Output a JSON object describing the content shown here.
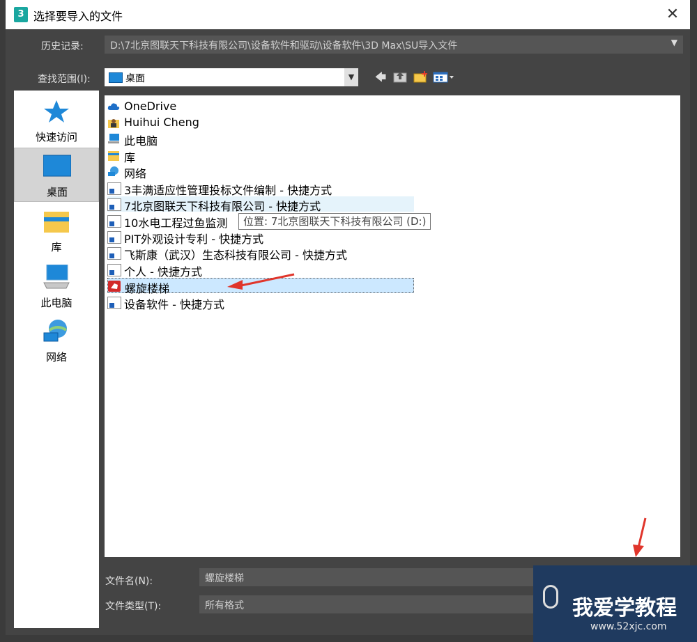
{
  "title_bar": {
    "app_icon": "3",
    "title": "选择要导入的文件",
    "close": "✕"
  },
  "history": {
    "label": "历史记录:",
    "value": "D:\\7北京图联天下科技有限公司\\设备软件和驱动\\设备软件\\3D Max\\SU导入文件"
  },
  "look_in": {
    "label": "查找范围(I):",
    "value": "桌面"
  },
  "places": [
    {
      "label": "快速访问",
      "icon": "star-icon"
    },
    {
      "label": "桌面",
      "icon": "desktop-icon"
    },
    {
      "label": "库",
      "icon": "library-icon"
    },
    {
      "label": "此电脑",
      "icon": "computer-icon"
    },
    {
      "label": "网络",
      "icon": "network-icon"
    }
  ],
  "files": [
    {
      "name": "OneDrive",
      "icon": "cloud-icon"
    },
    {
      "name": "Huihui Cheng",
      "icon": "user-folder-icon"
    },
    {
      "name": "此电脑",
      "icon": "computer-icon"
    },
    {
      "name": "库",
      "icon": "library-icon"
    },
    {
      "name": "网络",
      "icon": "network-icon"
    },
    {
      "name": "3丰满适应性管理投标文件编制 - 快捷方式",
      "icon": "shortcut-icon"
    },
    {
      "name": "7北京图联天下科技有限公司 - 快捷方式",
      "icon": "shortcut-icon"
    },
    {
      "name": "10水电工程过鱼监测",
      "icon": "shortcut-icon"
    },
    {
      "name": "PIT外观设计专利 - 快捷方式",
      "icon": "shortcut-icon"
    },
    {
      "name": "飞斯康（武汉）生态科技有限公司 - 快捷方式",
      "icon": "shortcut-icon"
    },
    {
      "name": "个人 - 快捷方式",
      "icon": "shortcut-icon"
    },
    {
      "name": "螺旋楼梯",
      "icon": "sketchup-file-icon"
    },
    {
      "name": "设备软件 - 快捷方式",
      "icon": "shortcut-icon"
    }
  ],
  "tooltip": "位置: 7北京图联天下科技有限公司 (D:)",
  "filename": {
    "label": "文件名(N):",
    "value": "螺旋楼梯"
  },
  "filetype": {
    "label": "文件类型(T):",
    "value": "所有格式"
  },
  "watermark": {
    "main": "我爱学教程",
    "sub": "www.52xjc.com"
  },
  "colors": {
    "accent_arrow": "#e0352b",
    "dialog_bg": "#444444",
    "selection": "#cce8ff"
  }
}
